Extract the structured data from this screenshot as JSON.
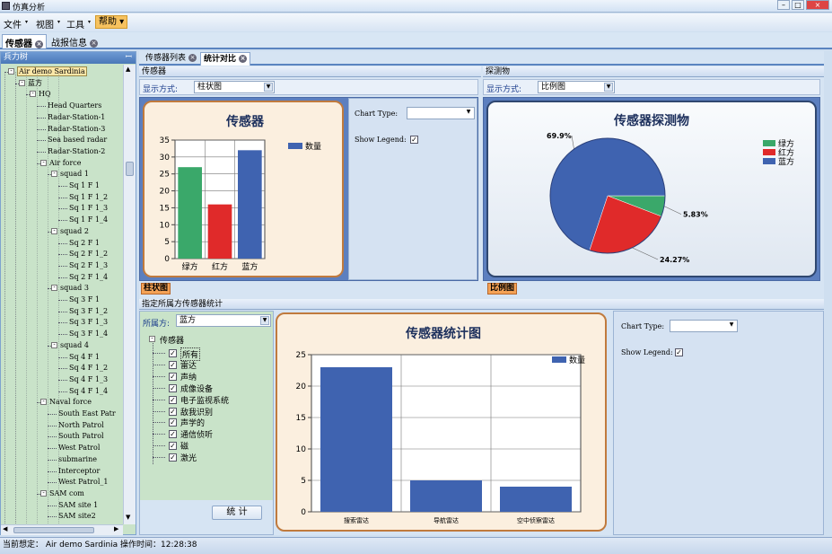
{
  "window": {
    "title": "仿真分析"
  },
  "menu": [
    {
      "label": "文件"
    },
    {
      "label": "视图"
    },
    {
      "label": "工具"
    },
    {
      "label": "帮助"
    }
  ],
  "doc_tabs": [
    {
      "label": "传感器"
    },
    {
      "label": "战报信息"
    }
  ],
  "left_panel": {
    "title": "兵力树",
    "tree": [
      {
        "label": "Air demo Sardinia",
        "level": 0,
        "expander": "-",
        "highlight": true
      },
      {
        "label": "蓝方",
        "level": 1,
        "expander": "-"
      },
      {
        "label": "HQ",
        "level": 2,
        "expander": "-"
      },
      {
        "label": "Head Quarters",
        "level": 3
      },
      {
        "label": "Radar-Station-1",
        "level": 3
      },
      {
        "label": "Radar-Station-3",
        "level": 3
      },
      {
        "label": "Sea based radar",
        "level": 3
      },
      {
        "label": "Radar-Station-2",
        "level": 3
      },
      {
        "label": "Air force",
        "level": 3,
        "expander": "-"
      },
      {
        "label": "squad 1",
        "level": 4,
        "expander": "-"
      },
      {
        "label": "Sq 1 F 1",
        "level": 5
      },
      {
        "label": "Sq 1 F 1_2",
        "level": 5
      },
      {
        "label": "Sq 1 F 1_3",
        "level": 5
      },
      {
        "label": "Sq 1 F 1_4",
        "level": 5
      },
      {
        "label": "squad 2",
        "level": 4,
        "expander": "-"
      },
      {
        "label": "Sq 2 F 1",
        "level": 5
      },
      {
        "label": "Sq 2 F 1_2",
        "level": 5
      },
      {
        "label": "Sq 2 F 1_3",
        "level": 5
      },
      {
        "label": "Sq 2 F 1_4",
        "level": 5
      },
      {
        "label": "squad 3",
        "level": 4,
        "expander": "-"
      },
      {
        "label": "Sq 3 F 1",
        "level": 5
      },
      {
        "label": "Sq 3 F 1_2",
        "level": 5
      },
      {
        "label": "Sq 3 F 1_3",
        "level": 5
      },
      {
        "label": "Sq 3 F 1_4",
        "level": 5
      },
      {
        "label": "squad 4",
        "level": 4,
        "expander": "-"
      },
      {
        "label": "Sq 4 F 1",
        "level": 5
      },
      {
        "label": "Sq 4 F 1_2",
        "level": 5
      },
      {
        "label": "Sq 4 F 1_3",
        "level": 5
      },
      {
        "label": "Sq 4 F 1_4",
        "level": 5
      },
      {
        "label": "Naval force",
        "level": 3,
        "expander": "-"
      },
      {
        "label": "South East Patr",
        "level": 4
      },
      {
        "label": "North Patrol",
        "level": 4
      },
      {
        "label": "South Patrol",
        "level": 4
      },
      {
        "label": "West Patrol",
        "level": 4
      },
      {
        "label": "submarine",
        "level": 4
      },
      {
        "label": "Interceptor",
        "level": 4
      },
      {
        "label": "West Patrol_1",
        "level": 4
      },
      {
        "label": "SAM com",
        "level": 3,
        "expander": "-"
      },
      {
        "label": "SAM site 1",
        "level": 4
      },
      {
        "label": "SAM site2",
        "level": 4
      }
    ]
  },
  "sub_tabs": [
    {
      "label": "传感器列表"
    },
    {
      "label": "统计对比"
    }
  ],
  "sensor_panel": {
    "header": "传感器",
    "display_label": "显示方式:",
    "display_value": "柱状图",
    "chart_type_label": "Chart Type:",
    "chart_type_value": "",
    "show_legend_label": "Show Legend:",
    "show_legend_checked": "✓",
    "footer_label": "柱状图"
  },
  "detect_panel": {
    "header": "探测物",
    "display_label": "显示方式:",
    "display_value": "比例图",
    "footer_label": "比例图"
  },
  "stats_panel": {
    "header": "指定所属方传感器统计",
    "owner_label": "所属方:",
    "owner_value": "蓝方",
    "tree_root": "传感器",
    "items": [
      {
        "label": "所有"
      },
      {
        "label": "雷达"
      },
      {
        "label": "声纳"
      },
      {
        "label": "成像设备"
      },
      {
        "label": "电子监视系统"
      },
      {
        "label": "敌我识别"
      },
      {
        "label": "声学的"
      },
      {
        "label": "通信侦听"
      },
      {
        "label": "磁"
      },
      {
        "label": "激光"
      }
    ],
    "stat_button": "统  计",
    "chart_type_label": "Chart Type:",
    "chart_type_value": "",
    "show_legend_label": "Show Legend:",
    "show_legend_checked": "✓"
  },
  "status": {
    "text": "当前想定：  Air demo Sardinia   操作时间：12:28:38"
  },
  "colors": {
    "green": "#3aa86a",
    "red": "#e02a2a",
    "blue": "#3f63b0"
  },
  "chart_data": [
    {
      "type": "bar",
      "title": "传感器",
      "categories": [
        "绿方",
        "红方",
        "蓝方"
      ],
      "values": [
        27,
        16,
        32
      ],
      "bar_colors": [
        "#3aa86a",
        "#e02a2a",
        "#3f63b0"
      ],
      "legend": [
        "数量"
      ],
      "yticks": [
        "0",
        "5",
        "10",
        "15",
        "20",
        "25",
        "30",
        "35"
      ],
      "ylim": [
        0,
        35
      ],
      "grid": true,
      "legend_position": "top-right"
    },
    {
      "type": "pie",
      "title": "传感器探测物",
      "slices": [
        {
          "label": "绿方",
          "value": 5.83,
          "color": "#3aa86a",
          "text": "5.83%"
        },
        {
          "label": "红方",
          "value": 24.27,
          "color": "#e02a2a",
          "text": "24.27%"
        },
        {
          "label": "蓝方",
          "value": 69.9,
          "color": "#3f63b0",
          "text": "69.9%"
        }
      ],
      "legend_position": "right"
    },
    {
      "type": "bar",
      "title": "传感器统计图",
      "categories": [
        "搜索雷达",
        "导航雷达",
        "空中侦察雷达"
      ],
      "values": [
        23,
        5,
        4
      ],
      "legend": [
        "数量"
      ],
      "yticks": [
        "0",
        "5",
        "10",
        "15",
        "20",
        "25"
      ],
      "ylim": [
        0,
        25
      ],
      "grid": true,
      "legend_position": "top-right"
    }
  ]
}
